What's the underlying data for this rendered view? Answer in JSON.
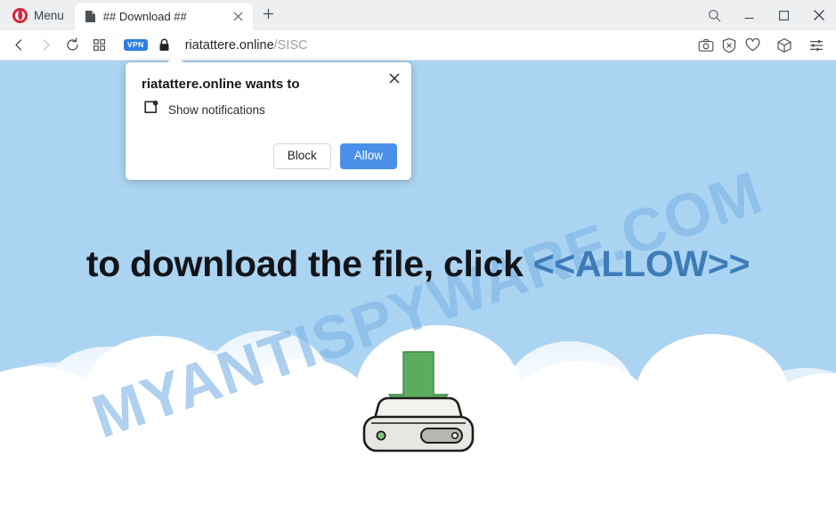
{
  "browser": {
    "menu_label": "Menu",
    "tab": {
      "title": "## Download ##",
      "favicon": "page-icon",
      "close_icon": "close-icon"
    },
    "new_tab_icon": "plus-icon",
    "window_controls": [
      {
        "name": "search-icon",
        "label": "Search"
      },
      {
        "name": "minimize-icon",
        "label": "Minimize"
      },
      {
        "name": "maximize-icon",
        "label": "Maximize"
      },
      {
        "name": "close-window-icon",
        "label": "Close"
      }
    ],
    "nav": {
      "back_icon": "back-arrow-icon",
      "forward_icon": "forward-arrow-icon",
      "reload_icon": "reload-icon",
      "speeddial_icon": "grid-icon"
    },
    "address": {
      "vpn_badge": "VPN",
      "lock_icon": "lock-icon",
      "url_host": "riatattere.online",
      "url_path": "/SISC"
    },
    "toolbar_icons": [
      {
        "name": "snapshot-icon",
        "label": "Snapshot"
      },
      {
        "name": "ad-blocker-icon",
        "label": "Ad blocker"
      },
      {
        "name": "heart-icon",
        "label": "Add to favorites"
      },
      {
        "name": "cube-icon",
        "label": "Extensions"
      },
      {
        "name": "settings-sliders-icon",
        "label": "Easy setup"
      }
    ]
  },
  "dialog": {
    "title": "riatattere.online wants to",
    "permission_icon": "notifications-permission-icon",
    "permission_label": "Show notifications",
    "block_label": "Block",
    "allow_label": "Allow",
    "close_icon": "close-icon"
  },
  "page": {
    "headline_before": "to download the file, click ",
    "headline_allow": "<<ALLOW>>",
    "watermark": "MYANTISPYWARE.COM",
    "graphic": "external-drive-download-icon",
    "colors": {
      "sky": "#abd4f2",
      "cloud": "#ffffff",
      "allow_text": "#3e7cb8",
      "arrow_green": "#5dab5e",
      "watermark": "#7fb4e4",
      "accent_blue": "#4a90e8",
      "vpn_blue": "#2f7fe0",
      "opera_red": "#d6243a"
    }
  }
}
